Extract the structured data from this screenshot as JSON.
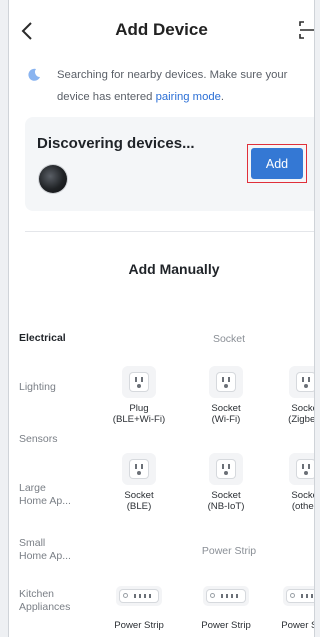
{
  "header": {
    "back_icon": "chevron-left-icon",
    "title": "Add Device",
    "scan_icon": "scan-icon"
  },
  "searching": {
    "text": "Searching for nearby devices. Make sure your device has entered ",
    "link": "pairing mode",
    "suffix": "."
  },
  "discover": {
    "title": "Discovering devices...",
    "add_label": "Add",
    "accent": "#3478d4",
    "highlight": "#e0303a"
  },
  "manual": {
    "title": "Add Manually"
  },
  "categories": [
    {
      "label": "Electrical",
      "active": true
    },
    {
      "label": "Lighting",
      "active": false
    },
    {
      "label": "Sensors",
      "active": false
    },
    {
      "label": "Large\nHome Ap...",
      "active": false
    },
    {
      "label": "Small\nHome Ap...",
      "active": false
    },
    {
      "label": "Kitchen\nAppliances",
      "active": false
    }
  ],
  "sections": {
    "socket": "Socket",
    "power_strip": "Power Strip"
  },
  "socket_items": [
    {
      "label": "Plug\n(BLE+Wi-Fi)",
      "icon": "socket-icon"
    },
    {
      "label": "Socket\n(Wi-Fi)",
      "icon": "socket-icon"
    },
    {
      "label": "Socket\n(Zigbee)",
      "icon": "socket-icon"
    },
    {
      "label": "Socket\n(BLE)",
      "icon": "socket-icon"
    },
    {
      "label": "Socket\n(NB-IoT)",
      "icon": "socket-icon"
    },
    {
      "label": "Socket\n(other)",
      "icon": "socket-icon"
    }
  ],
  "strip_items": [
    {
      "label": "Power Strip",
      "icon": "power-strip-icon"
    },
    {
      "label": "Power Strip",
      "icon": "power-strip-icon"
    },
    {
      "label": "Power Strip",
      "icon": "power-strip-icon"
    }
  ]
}
